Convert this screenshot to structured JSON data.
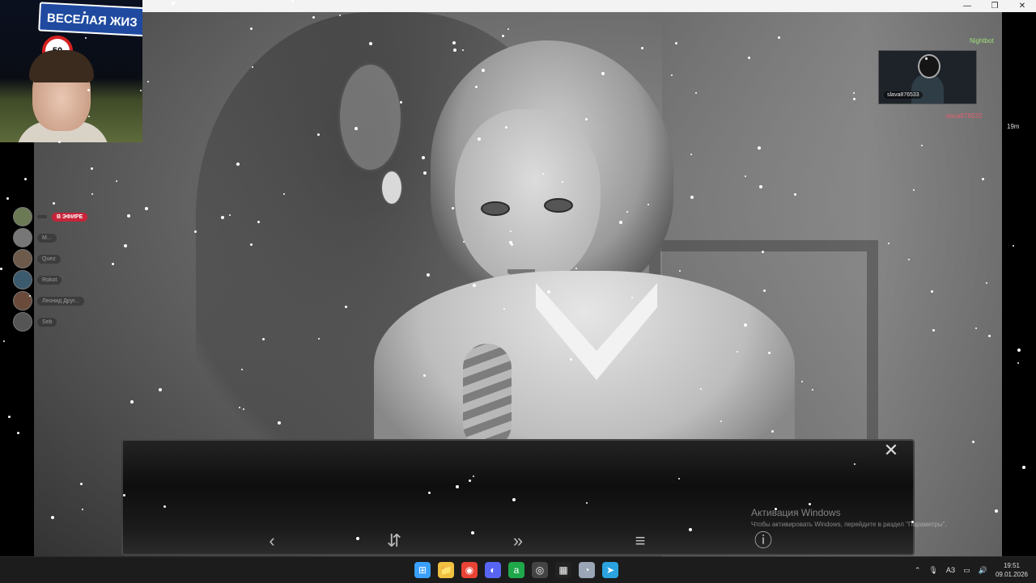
{
  "window": {
    "controls": [
      "—",
      "❐",
      "✕"
    ]
  },
  "webcam": {
    "road_sign": "ВЕСЕЛАЯ ЖИЗ",
    "speed_sign": "50"
  },
  "chat": {
    "live_badge": "В ЭФИРЕ",
    "rows": [
      {
        "text": "",
        "color": "#6b7a55"
      },
      {
        "text": "M...",
        "color": "#777777"
      },
      {
        "text": "Quez",
        "color": "#6e5a4a"
      },
      {
        "text": "Rokot",
        "color": "#3b5a6e"
      },
      {
        "text": "Леонид Друг...",
        "color": "#6a4a3a"
      },
      {
        "text": "Seb",
        "color": "#555555"
      }
    ]
  },
  "alert": {
    "bot_name": "Nightbot",
    "user_tag": "slava876533",
    "user_name": "slava876533",
    "extra": "19m"
  },
  "dialog": {
    "close_label": "✕",
    "buttons": [
      "‹",
      "⇵",
      "»",
      "≡",
      "ⓘ"
    ]
  },
  "windows_activation": {
    "title": "Активация Windows",
    "subtitle": "Чтобы активировать Windows, перейдите в раздел \"Параметры\"."
  },
  "taskbar": {
    "apps": [
      {
        "name": "windows-start",
        "glyph": "⊞",
        "color": "#3aa0ff"
      },
      {
        "name": "file-explorer",
        "glyph": "📁",
        "color": "#f0c040"
      },
      {
        "name": "chrome",
        "glyph": "◉",
        "color": "#e94335"
      },
      {
        "name": "discord",
        "glyph": "◐",
        "color": "#5865f2"
      },
      {
        "name": "app-a",
        "glyph": "a",
        "color": "#1fa84a"
      },
      {
        "name": "obs",
        "glyph": "◎",
        "color": "#444444"
      },
      {
        "name": "terminal",
        "glyph": "▦",
        "color": "#222222"
      },
      {
        "name": "app-chat",
        "glyph": "◔",
        "color": "#9aa5b5"
      },
      {
        "name": "telegram",
        "glyph": "➤",
        "color": "#2aa3df"
      }
    ],
    "tray_lang": "АЗ",
    "time": "19:51",
    "date": "09.01.2026"
  }
}
